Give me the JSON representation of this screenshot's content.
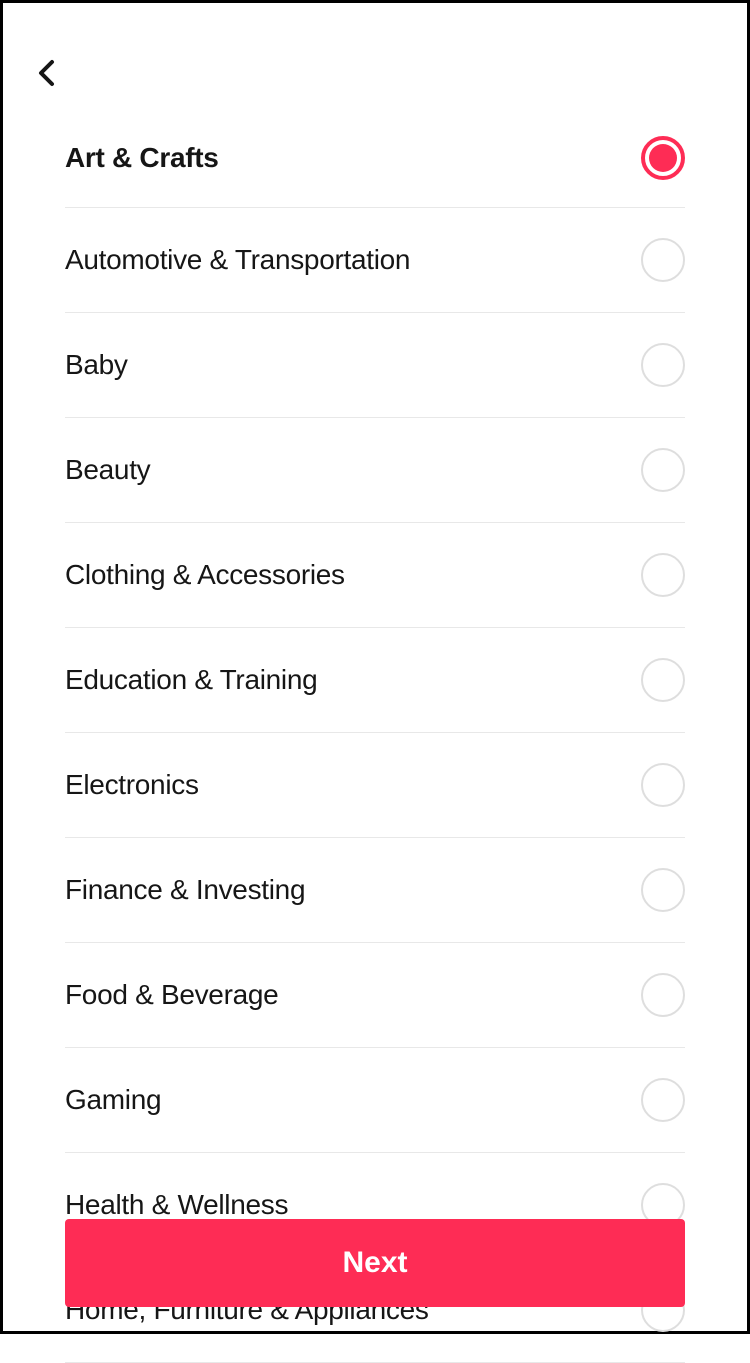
{
  "categories": [
    {
      "label": "Art & Crafts",
      "selected": true
    },
    {
      "label": "Automotive & Transportation",
      "selected": false
    },
    {
      "label": "Baby",
      "selected": false
    },
    {
      "label": "Beauty",
      "selected": false
    },
    {
      "label": "Clothing & Accessories",
      "selected": false
    },
    {
      "label": "Education & Training",
      "selected": false
    },
    {
      "label": "Electronics",
      "selected": false
    },
    {
      "label": "Finance & Investing",
      "selected": false
    },
    {
      "label": "Food & Beverage",
      "selected": false
    },
    {
      "label": "Gaming",
      "selected": false
    },
    {
      "label": "Health & Wellness",
      "selected": false
    },
    {
      "label": "Home, Furniture & Appliances",
      "selected": false
    }
  ],
  "next_button_label": "Next"
}
